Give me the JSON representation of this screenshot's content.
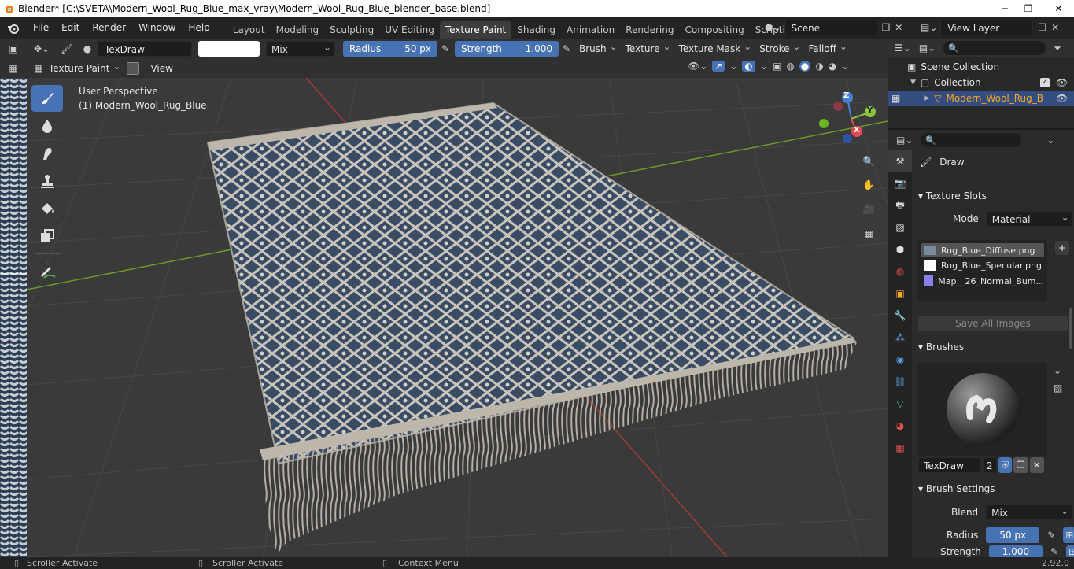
{
  "window": {
    "title": "Blender* [C:\\SVETA\\Modern_Wool_Rug_Blue_max_vray\\Modern_Wool_Rug_Blue_blender_base.blend]"
  },
  "menu": [
    "File",
    "Edit",
    "Render",
    "Window",
    "Help"
  ],
  "workspaces": [
    "Layout",
    "Modeling",
    "Sculpting",
    "UV Editing",
    "Texture Paint",
    "Shading",
    "Animation",
    "Rendering",
    "Compositing",
    "Scripting"
  ],
  "active_workspace": "Texture Paint",
  "scene": {
    "name": "Scene",
    "view_layer": "View Layer"
  },
  "tool_header": {
    "brush_name": "TexDraw",
    "blend": "Mix",
    "radius_label": "Radius",
    "radius_value": "50 px",
    "strength_label": "Strength",
    "strength_value": "1.000",
    "menus": [
      "Brush",
      "Texture",
      "Texture Mask",
      "Stroke",
      "Falloff"
    ]
  },
  "viewport_header": {
    "mode": "Texture Paint",
    "view": "View"
  },
  "viewport": {
    "perspective": "User Perspective",
    "object": "(1) Modern_Wool_Rug_Blue"
  },
  "gizmo": {
    "z": "Z",
    "y": "Y",
    "x": "X"
  },
  "outliner": {
    "scene_collection": "Scene Collection",
    "collection": "Collection",
    "object": "Modern_Wool_Rug_B"
  },
  "properties": {
    "tool_name": "Draw",
    "texture_slots": {
      "header": "Texture Slots",
      "mode_label": "Mode",
      "mode_value": "Material",
      "slots": [
        "Rug_Blue_Diffuse.png",
        "Rug_Blue_Specular.png",
        "Map__26_Normal_Bum..."
      ],
      "save_all": "Save All Images"
    },
    "brushes": {
      "header": "Brushes",
      "name": "TexDraw",
      "users": "2"
    },
    "brush_settings": {
      "header": "Brush Settings",
      "blend_label": "Blend",
      "blend_value": "Mix",
      "radius_label": "Radius",
      "radius_value": "50 px",
      "strength_label": "Strength",
      "strength_value": "1.000"
    }
  },
  "statusbar": {
    "left": "Scroller Activate",
    "middle": "Scroller Activate",
    "right": "Context Menu",
    "version": "2.92.0"
  },
  "colors": {
    "accent": "#4772b3",
    "active_object": "#f5a623",
    "grid_red": "#a33a3a",
    "grid_green": "#6a9a2a"
  }
}
